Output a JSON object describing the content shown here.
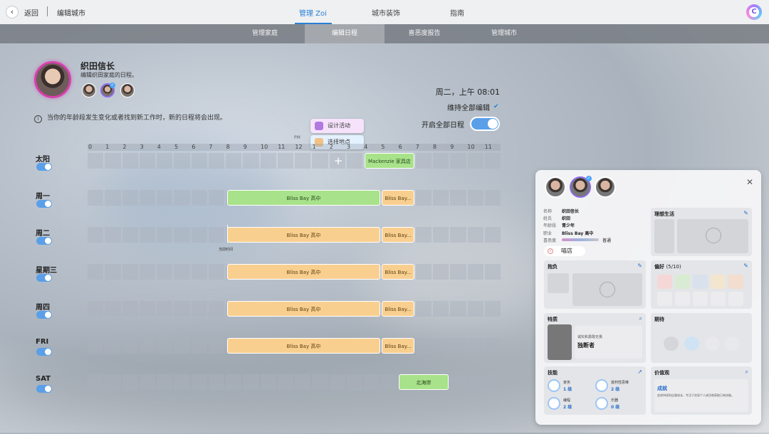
{
  "topbar": {
    "back": "返回",
    "edit_city": "编辑城市",
    "tabs": [
      "管理 Zoi",
      "城市装饰",
      "指南"
    ]
  },
  "subtabs": [
    "管理家庭",
    "编辑日程",
    "喜恶度报告",
    "管理城市"
  ],
  "household": {
    "name": "织田信长",
    "subtitle": "编辑织田家庭的日程。"
  },
  "info": "当你的年龄段发生变化或者找到新工作时，新的日程将会出现。",
  "clock": "周二，上午 08:01",
  "keep_edit": "维持全部编辑",
  "enable_all": "开启全部日程",
  "popups": {
    "design": "设计活动",
    "location": "选择地点"
  },
  "hours": [
    "0",
    "1",
    "2",
    "3",
    "4",
    "5",
    "6",
    "7",
    "8",
    "9",
    "10",
    "11",
    "12",
    "1",
    "2",
    "3",
    "4",
    "5",
    "6",
    "7",
    "8",
    "9",
    "10",
    "11"
  ],
  "pm_marker": "PM",
  "days": [
    "太阳",
    "周一",
    "周二",
    "星期三",
    "周四",
    "FRI",
    "SAT"
  ],
  "blocks": {
    "sun": "Mackenzie 家具店",
    "school": "Bliss Bay 高中",
    "school_short": "Bliss Bay...",
    "sat": "北海岸"
  },
  "time_marker": "当前时间",
  "panel": {
    "fields": [
      {
        "k": "名称",
        "v": "织田信长"
      },
      {
        "k": "姓氏",
        "v": "织田"
      },
      {
        "k": "年龄段",
        "v": "青少年"
      },
      {
        "k": "职业",
        "v": "Bliss Bay 高中"
      },
      {
        "k": "喜恶度",
        "v": ""
      }
    ],
    "mood": "普通",
    "store": "喵店",
    "ideal_life": "理想生活",
    "burden": "抱负",
    "preferences": "偏好",
    "pref_count": "(5/10)",
    "traits": "特质",
    "trait_desc": "诚实和勇敢无畏",
    "trait_name": "独断者",
    "expect": "期待",
    "skills": "技能",
    "values": "价值观",
    "skill_list": [
      {
        "name": "家务",
        "level": "1 级"
      },
      {
        "name": "批判性思维",
        "level": "2 级"
      },
      {
        "name": "编程",
        "level": "2 级"
      },
      {
        "name": "乐器",
        "level": "0 级"
      }
    ],
    "value_name": "成就",
    "value_desc": "追求持续的自我成长，专注于实现个人成功和获取已有技能。"
  },
  "colors": {
    "accent": "#2a7fd4",
    "green": "#a8e28a",
    "orange": "#f9cf90",
    "toggle": "#5a9fe8"
  }
}
